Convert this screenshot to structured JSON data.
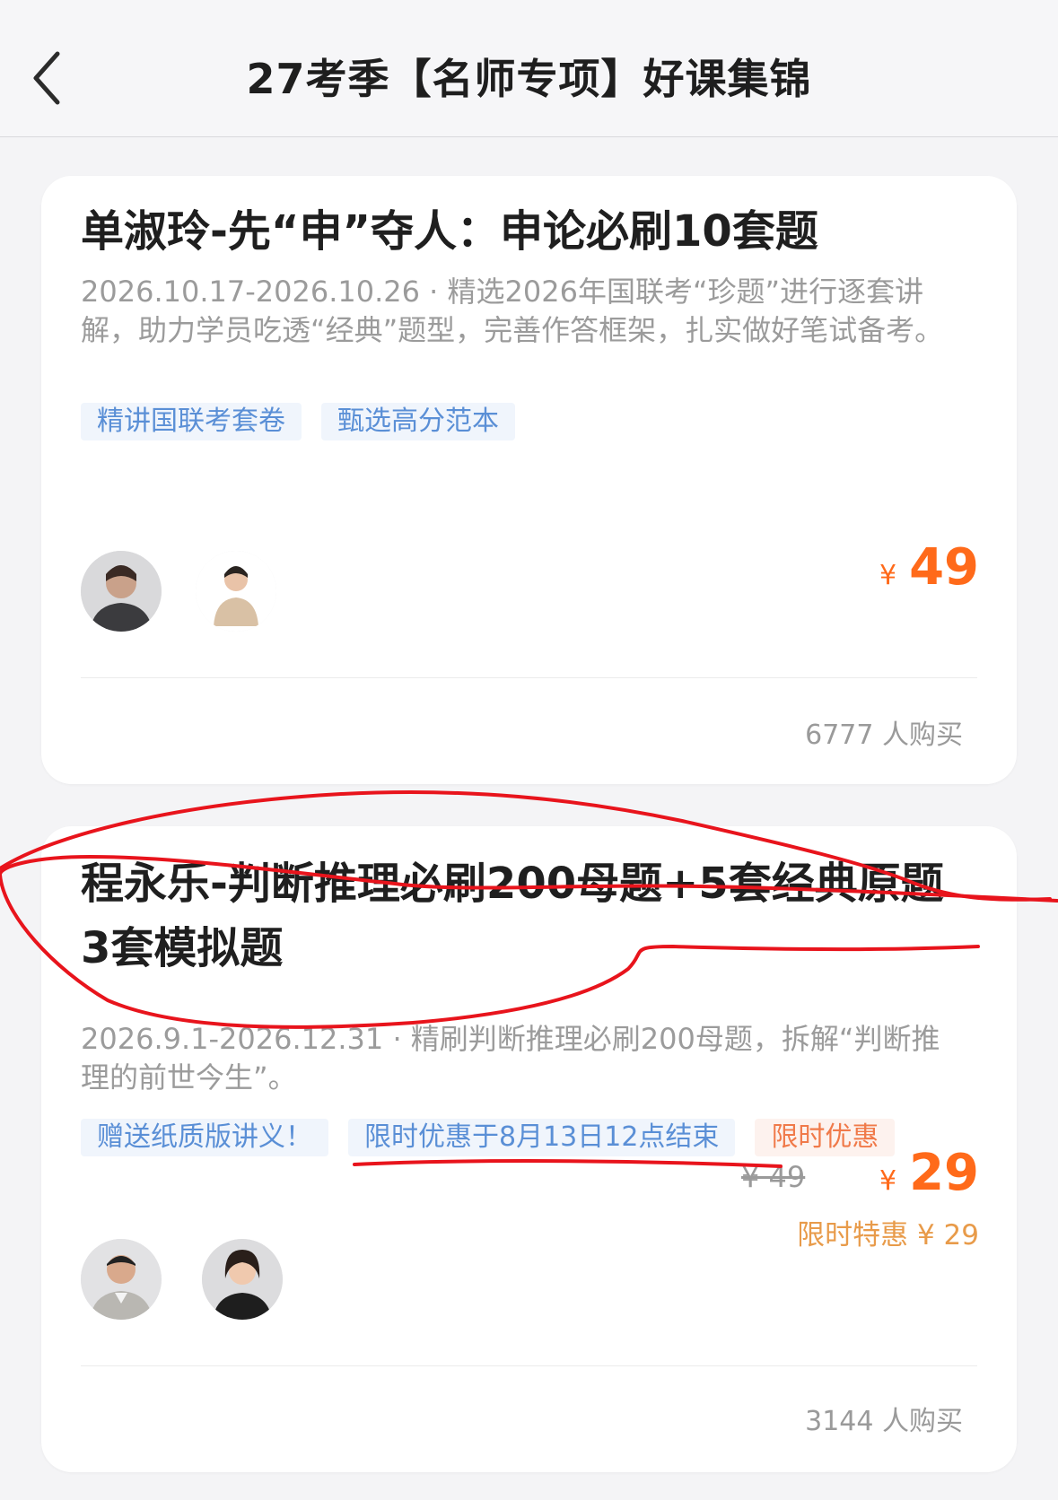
{
  "header": {
    "title": "27考季【名师专项】好课集锦"
  },
  "courses": [
    {
      "title": "单淑玲-先“申”夺人：申论必刷10套题",
      "description": "2026.10.17-2026.10.26 · 精选2026年国联考“珍题”进行逐套讲解，助力学员吃透“经典”题型，完善作答框架，扎实做好笔试备考。",
      "tags": [
        "精讲国联考套卷",
        "甄选高分范本"
      ],
      "currency": "¥",
      "price": "49",
      "buyers": "6777 人购买"
    },
    {
      "title": "程永乐-判断推理必刷200母题+5套经典原题 3套模拟题",
      "description": "2026.9.1-2026.12.31 · 精刷判断推理必刷200母题，拆解“判断推理的前世今生”。",
      "tags": [
        "赠送纸质版讲义！",
        "限时优惠于8月13日12点结束",
        "限时优惠"
      ],
      "original_price": "¥ 49",
      "currency": "¥",
      "price": "29",
      "promo_text": "限时特惠 ¥ 29",
      "buyers": "3144 人购买"
    }
  ],
  "colors": {
    "price": "#ff6a1a",
    "tag_blue": "#5a8fd6",
    "tag_orange": "#f07a4a",
    "annotation_red": "#e8141c"
  }
}
